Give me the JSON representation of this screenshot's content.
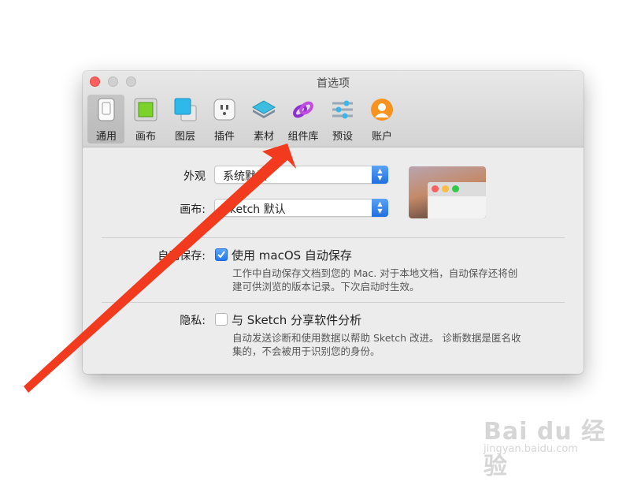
{
  "window": {
    "title": "首选项"
  },
  "toolbar": {
    "tabs": [
      {
        "label": "通用",
        "icon": "general-icon",
        "selected": true
      },
      {
        "label": "画布",
        "icon": "canvas-icon"
      },
      {
        "label": "图层",
        "icon": "layers-icon"
      },
      {
        "label": "插件",
        "icon": "plugins-icon"
      },
      {
        "label": "素材",
        "icon": "assets-icon"
      },
      {
        "label": "组件库",
        "icon": "libraries-icon"
      },
      {
        "label": "预设",
        "icon": "presets-icon"
      },
      {
        "label": "账户",
        "icon": "account-icon"
      }
    ]
  },
  "general": {
    "appearance_label": "外观",
    "appearance_value": "系统默认",
    "canvas_label": "画布:",
    "canvas_value": "Sketch 默认",
    "autosave_label": "自动保存:",
    "autosave_checkbox": "使用 macOS 自动保存",
    "autosave_checked": true,
    "autosave_desc": "工作中自动保存文档到您的 Mac. 对于本地文档，自动保存还将创建可供浏览的版本记录。下次启动时生效。",
    "privacy_label": "隐私:",
    "privacy_checkbox": "与 Sketch 分享软件分析",
    "privacy_checked": false,
    "privacy_desc": "自动发送诊断和使用数据以帮助 Sketch 改进。 诊断数据是匿名收集的，不会被用于识别您的身份。"
  },
  "annotation": {
    "arrow_color": "#f23a1f"
  },
  "watermark": {
    "brand": "Bai du 经验",
    "url": "jingyan.baidu.com"
  }
}
